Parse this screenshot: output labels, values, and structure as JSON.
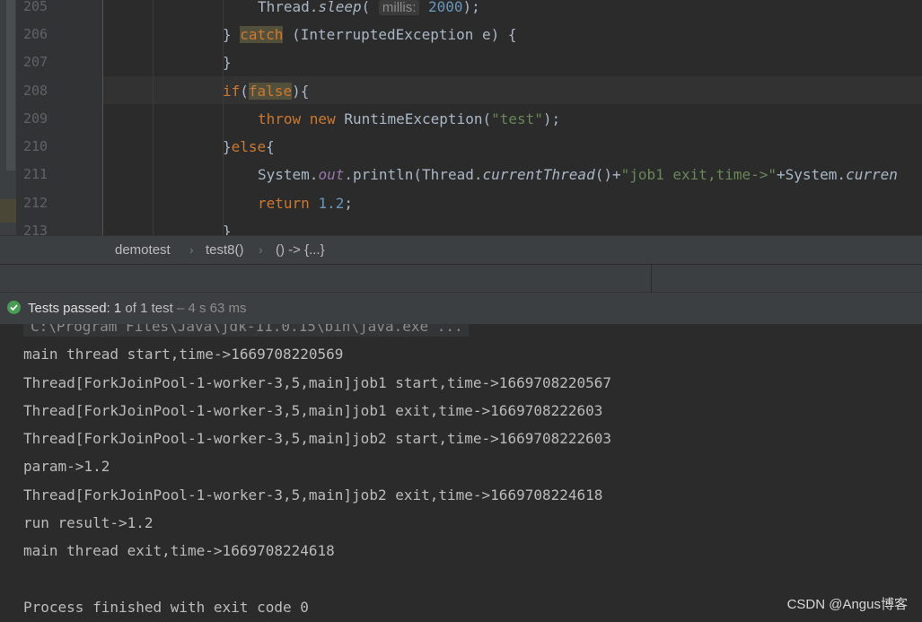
{
  "editor": {
    "line_numbers": [
      "205",
      "206",
      "207",
      "208",
      "209",
      "210",
      "211",
      "212",
      "213"
    ],
    "l205": {
      "a": "Thread.",
      "b": "sleep",
      "c": "( ",
      "hint": "millis:",
      "d": " ",
      "num": "2000",
      "e": ");"
    },
    "l206": {
      "a": "} ",
      "kw": "catch",
      "b": " (InterruptedException e) {"
    },
    "l207": {
      "a": "}"
    },
    "l208": {
      "kw": "if",
      "b": "(",
      "kw2": "false",
      "c": "){"
    },
    "l209": {
      "kw": "throw new",
      "b": " RuntimeException(",
      "str": "\"test\"",
      "c": ");"
    },
    "l210": {
      "a": "}",
      "kw": "else",
      "b": "{"
    },
    "l211": {
      "a": "System.",
      "fld": "out",
      "b": ".println(Thread.",
      "itl": "currentThread",
      "c": "()+",
      "str": "\"job1 exit,time->\"",
      "d": "+System.",
      "itl2": "curren"
    },
    "l212": {
      "kw": "return",
      "b": " ",
      "num": "1.2",
      "c": ";"
    },
    "l213": {
      "a": "}"
    }
  },
  "breadcrumb": {
    "items": [
      "demotest",
      "test8()",
      "() -> {...}"
    ]
  },
  "status": {
    "part1": "Tests passed: ",
    "part2": "1",
    "part3": " of 1 test",
    "part4": " – 4 s 63 ms"
  },
  "console": {
    "command": "C:\\Program Files\\Java\\jdk-11.0.15\\bin\\java.exe ...",
    "lines": [
      "main thread start,time->1669708220569",
      "Thread[ForkJoinPool-1-worker-3,5,main]job1 start,time->1669708220567",
      "Thread[ForkJoinPool-1-worker-3,5,main]job1 exit,time->1669708222603",
      "Thread[ForkJoinPool-1-worker-3,5,main]job2 start,time->1669708222603",
      "param->1.2",
      "Thread[ForkJoinPool-1-worker-3,5,main]job2 exit,time->1669708224618",
      "run result->1.2",
      "main thread exit,time->1669708224618",
      "",
      "Process finished with exit code 0"
    ]
  },
  "watermark": "CSDN @Angus博客",
  "colors": {
    "editor_bg": "#2b2b2b",
    "keyword": "#cc7832",
    "string": "#6a8759",
    "number": "#6897bb",
    "success": "#499c54"
  },
  "icons": [
    "check-circle-icon",
    "chevron-right-icon"
  ]
}
